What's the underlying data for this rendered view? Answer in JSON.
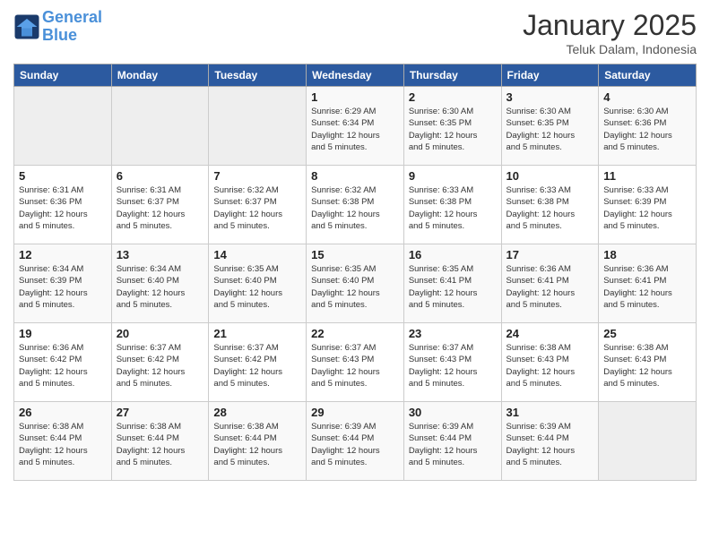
{
  "logo": {
    "line1": "General",
    "line2": "Blue"
  },
  "title": "January 2025",
  "subtitle": "Teluk Dalam, Indonesia",
  "days_of_week": [
    "Sunday",
    "Monday",
    "Tuesday",
    "Wednesday",
    "Thursday",
    "Friday",
    "Saturday"
  ],
  "weeks": [
    [
      {
        "day": "",
        "info": ""
      },
      {
        "day": "",
        "info": ""
      },
      {
        "day": "",
        "info": ""
      },
      {
        "day": "1",
        "info": "Sunrise: 6:29 AM\nSunset: 6:34 PM\nDaylight: 12 hours\nand 5 minutes."
      },
      {
        "day": "2",
        "info": "Sunrise: 6:30 AM\nSunset: 6:35 PM\nDaylight: 12 hours\nand 5 minutes."
      },
      {
        "day": "3",
        "info": "Sunrise: 6:30 AM\nSunset: 6:35 PM\nDaylight: 12 hours\nand 5 minutes."
      },
      {
        "day": "4",
        "info": "Sunrise: 6:30 AM\nSunset: 6:36 PM\nDaylight: 12 hours\nand 5 minutes."
      }
    ],
    [
      {
        "day": "5",
        "info": "Sunrise: 6:31 AM\nSunset: 6:36 PM\nDaylight: 12 hours\nand 5 minutes."
      },
      {
        "day": "6",
        "info": "Sunrise: 6:31 AM\nSunset: 6:37 PM\nDaylight: 12 hours\nand 5 minutes."
      },
      {
        "day": "7",
        "info": "Sunrise: 6:32 AM\nSunset: 6:37 PM\nDaylight: 12 hours\nand 5 minutes."
      },
      {
        "day": "8",
        "info": "Sunrise: 6:32 AM\nSunset: 6:38 PM\nDaylight: 12 hours\nand 5 minutes."
      },
      {
        "day": "9",
        "info": "Sunrise: 6:33 AM\nSunset: 6:38 PM\nDaylight: 12 hours\nand 5 minutes."
      },
      {
        "day": "10",
        "info": "Sunrise: 6:33 AM\nSunset: 6:38 PM\nDaylight: 12 hours\nand 5 minutes."
      },
      {
        "day": "11",
        "info": "Sunrise: 6:33 AM\nSunset: 6:39 PM\nDaylight: 12 hours\nand 5 minutes."
      }
    ],
    [
      {
        "day": "12",
        "info": "Sunrise: 6:34 AM\nSunset: 6:39 PM\nDaylight: 12 hours\nand 5 minutes."
      },
      {
        "day": "13",
        "info": "Sunrise: 6:34 AM\nSunset: 6:40 PM\nDaylight: 12 hours\nand 5 minutes."
      },
      {
        "day": "14",
        "info": "Sunrise: 6:35 AM\nSunset: 6:40 PM\nDaylight: 12 hours\nand 5 minutes."
      },
      {
        "day": "15",
        "info": "Sunrise: 6:35 AM\nSunset: 6:40 PM\nDaylight: 12 hours\nand 5 minutes."
      },
      {
        "day": "16",
        "info": "Sunrise: 6:35 AM\nSunset: 6:41 PM\nDaylight: 12 hours\nand 5 minutes."
      },
      {
        "day": "17",
        "info": "Sunrise: 6:36 AM\nSunset: 6:41 PM\nDaylight: 12 hours\nand 5 minutes."
      },
      {
        "day": "18",
        "info": "Sunrise: 6:36 AM\nSunset: 6:41 PM\nDaylight: 12 hours\nand 5 minutes."
      }
    ],
    [
      {
        "day": "19",
        "info": "Sunrise: 6:36 AM\nSunset: 6:42 PM\nDaylight: 12 hours\nand 5 minutes."
      },
      {
        "day": "20",
        "info": "Sunrise: 6:37 AM\nSunset: 6:42 PM\nDaylight: 12 hours\nand 5 minutes."
      },
      {
        "day": "21",
        "info": "Sunrise: 6:37 AM\nSunset: 6:42 PM\nDaylight: 12 hours\nand 5 minutes."
      },
      {
        "day": "22",
        "info": "Sunrise: 6:37 AM\nSunset: 6:43 PM\nDaylight: 12 hours\nand 5 minutes."
      },
      {
        "day": "23",
        "info": "Sunrise: 6:37 AM\nSunset: 6:43 PM\nDaylight: 12 hours\nand 5 minutes."
      },
      {
        "day": "24",
        "info": "Sunrise: 6:38 AM\nSunset: 6:43 PM\nDaylight: 12 hours\nand 5 minutes."
      },
      {
        "day": "25",
        "info": "Sunrise: 6:38 AM\nSunset: 6:43 PM\nDaylight: 12 hours\nand 5 minutes."
      }
    ],
    [
      {
        "day": "26",
        "info": "Sunrise: 6:38 AM\nSunset: 6:44 PM\nDaylight: 12 hours\nand 5 minutes."
      },
      {
        "day": "27",
        "info": "Sunrise: 6:38 AM\nSunset: 6:44 PM\nDaylight: 12 hours\nand 5 minutes."
      },
      {
        "day": "28",
        "info": "Sunrise: 6:38 AM\nSunset: 6:44 PM\nDaylight: 12 hours\nand 5 minutes."
      },
      {
        "day": "29",
        "info": "Sunrise: 6:39 AM\nSunset: 6:44 PM\nDaylight: 12 hours\nand 5 minutes."
      },
      {
        "day": "30",
        "info": "Sunrise: 6:39 AM\nSunset: 6:44 PM\nDaylight: 12 hours\nand 5 minutes."
      },
      {
        "day": "31",
        "info": "Sunrise: 6:39 AM\nSunset: 6:44 PM\nDaylight: 12 hours\nand 5 minutes."
      },
      {
        "day": "",
        "info": ""
      }
    ]
  ]
}
